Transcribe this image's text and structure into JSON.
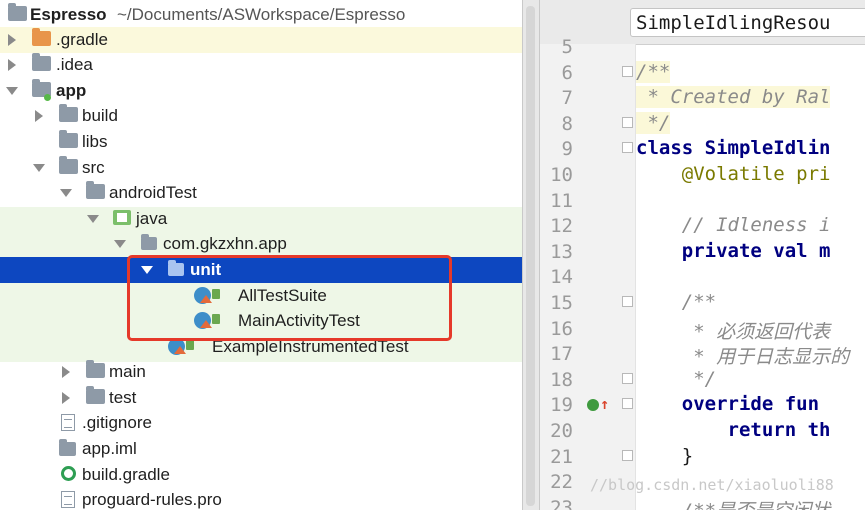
{
  "tree": {
    "root": {
      "name": "Espresso",
      "path": "~/Documents/ASWorkspace/Espresso"
    },
    "rows": [
      {
        "label": ".gradle"
      },
      {
        "label": ".idea"
      },
      {
        "label": "app"
      },
      {
        "label": "build"
      },
      {
        "label": "libs"
      },
      {
        "label": "src"
      },
      {
        "label": "androidTest"
      },
      {
        "label": "java"
      },
      {
        "label": "com.gkzxhn.app"
      },
      {
        "label": "unit"
      },
      {
        "label": "AllTestSuite"
      },
      {
        "label": "MainActivityTest"
      },
      {
        "label": "ExampleInstrumentedTest"
      },
      {
        "label": "main"
      },
      {
        "label": "test"
      },
      {
        "label": ".gitignore"
      },
      {
        "label": "app.iml"
      },
      {
        "label": "build.gradle"
      },
      {
        "label": "proguard-rules.pro"
      }
    ]
  },
  "editor": {
    "tab_title": "SimpleIdlingResou",
    "lines": [
      {
        "n": "5",
        "text": ""
      },
      {
        "n": "6",
        "text": "/**"
      },
      {
        "n": "7",
        "text": " * Created by Ral"
      },
      {
        "n": "8",
        "text": " */"
      },
      {
        "n": "9",
        "text": "class SimpleIdlin"
      },
      {
        "n": "10",
        "text": "    @Volatile pri"
      },
      {
        "n": "11",
        "text": ""
      },
      {
        "n": "12",
        "text": "    // Idleness i"
      },
      {
        "n": "13",
        "text": "    private val m"
      },
      {
        "n": "14",
        "text": ""
      },
      {
        "n": "15",
        "text": "    /**"
      },
      {
        "n": "16",
        "text": "     * 必须返回代表"
      },
      {
        "n": "17",
        "text": "     * 用于日志显示的"
      },
      {
        "n": "18",
        "text": "     */"
      },
      {
        "n": "19",
        "text": "    override fun "
      },
      {
        "n": "20",
        "text": "        return th"
      },
      {
        "n": "21",
        "text": "    }"
      },
      {
        "n": "22",
        "text": ""
      },
      {
        "n": "23",
        "text": "    /**是否是空闲状"
      }
    ],
    "watermark": "//blog.csdn.net/xiaoluoli88"
  },
  "colors": {
    "selection": "#0d47c0",
    "highlight_box": "#e5392a",
    "test_bg": "#eef7e7"
  }
}
